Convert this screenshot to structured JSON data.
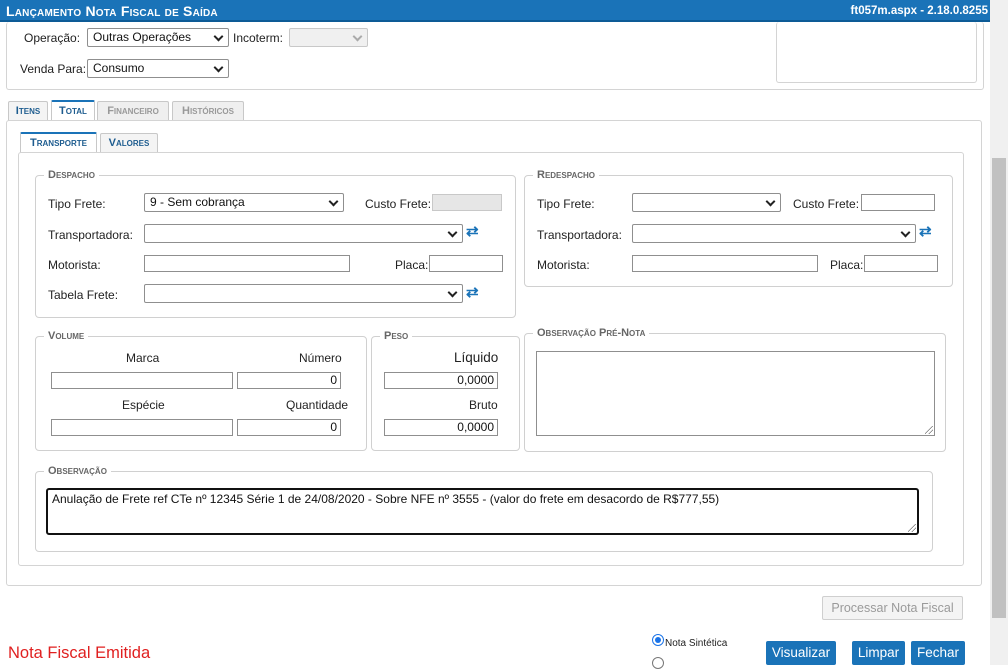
{
  "window": {
    "title": "Lançamento Nota Fiscal de Saída",
    "version": "ft057m.aspx - 2.18.0.8255"
  },
  "header": {
    "operacao_label": "Operação:",
    "operacao_value": "Outras Operações",
    "incoterm_label": "Incoterm:",
    "incoterm_value": "",
    "venda_para_label": "Venda Para:",
    "venda_para_value": "Consumo"
  },
  "tabs": [
    {
      "label": "Itens"
    },
    {
      "label": "Total"
    },
    {
      "label": "Financeiro"
    },
    {
      "label": "Históricos"
    }
  ],
  "subtabs": [
    {
      "label": "Transporte"
    },
    {
      "label": "Valores"
    }
  ],
  "despacho": {
    "legend": "Despacho",
    "tipo_frete_label": "Tipo Frete:",
    "tipo_frete_value": "9 - Sem cobrança",
    "custo_frete_label": "Custo Frete:",
    "custo_frete_value": "",
    "transportadora_label": "Transportadora:",
    "transportadora_value": "",
    "motorista_label": "Motorista:",
    "motorista_value": "",
    "placa_label": "Placa:",
    "placa_value": "",
    "tabela_frete_label": "Tabela Frete:",
    "tabela_frete_value": ""
  },
  "redespacho": {
    "legend": "Redespacho",
    "tipo_frete_label": "Tipo Frete:",
    "tipo_frete_value": "",
    "custo_frete_label": "Custo Frete:",
    "custo_frete_value": "",
    "transportadora_label": "Transportadora:",
    "transportadora_value": "",
    "motorista_label": "Motorista:",
    "motorista_value": "",
    "placa_label": "Placa:",
    "placa_value": ""
  },
  "volume": {
    "legend": "Volume",
    "marca_label": "Marca",
    "marca_value": "",
    "numero_label": "Número",
    "numero_value": "0",
    "especie_label": "Espécie",
    "especie_value": "",
    "quantidade_label": "Quantidade",
    "quantidade_value": "0"
  },
  "peso": {
    "legend": "Peso",
    "liquido_label": "Líquido",
    "liquido_value": "0,0000",
    "bruto_label": "Bruto",
    "bruto_value": "0,0000"
  },
  "obs_pre_nota": {
    "legend": "Observação Pré-Nota",
    "value": ""
  },
  "observacao": {
    "legend": "Observação",
    "value": "Anulação de Frete ref CTe nº 12345 Série 1 de 24/08/2020 - Sobre NFE nº 3555 - (valor do frete em desacordo de R$777,55)"
  },
  "footer": {
    "processar_label": "Processar Nota Fiscal",
    "status_text": "Nota Fiscal Emitida",
    "radio_sintetica_label": "Nota Sintética",
    "visualizar_label": "Visualizar",
    "limpar_label": "Limpar",
    "fechar_label": "Fechar"
  },
  "colors": {
    "accent": "#1a73b8",
    "status": "#e02020"
  },
  "icons": {
    "refresh": "refresh-icon",
    "dropdown": "chevron-down-icon"
  }
}
